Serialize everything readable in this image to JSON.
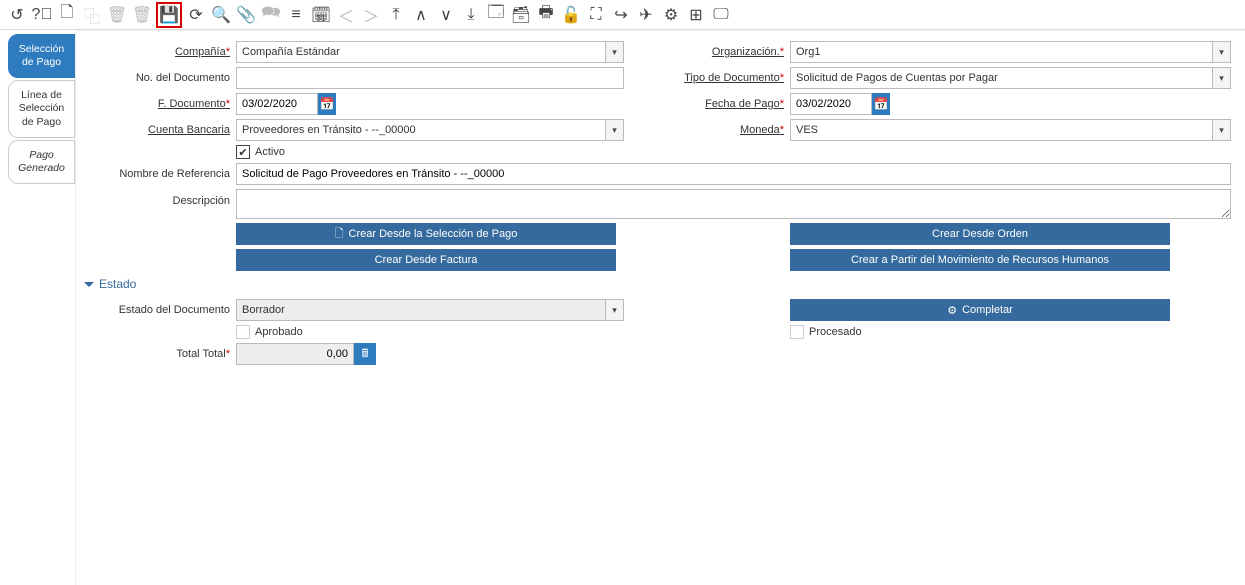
{
  "sidebar": {
    "tabs": [
      {
        "label": "Selección de Pago"
      },
      {
        "label": "Línea de Selección de Pago"
      },
      {
        "label": "Pago Generado"
      }
    ]
  },
  "fields": {
    "compania": {
      "label": "Compañía",
      "value": "Compañía Estándar"
    },
    "organizacion": {
      "label": "Organización.",
      "value": "Org1"
    },
    "no_documento": {
      "label": "No. del Documento",
      "value": ""
    },
    "tipo_documento": {
      "label": "Tipo de Documento",
      "value": "Solicitud de Pagos de Cuentas por Pagar"
    },
    "f_documento": {
      "label": "F. Documento",
      "value": "03/02/2020"
    },
    "fecha_pago": {
      "label": "Fecha de Pago",
      "value": "03/02/2020"
    },
    "cuenta_bancaria": {
      "label": "Cuenta Bancaria",
      "value": "Proveedores en Tránsito - --_00000"
    },
    "moneda": {
      "label": "Moneda",
      "value": "VES"
    },
    "activo": {
      "label": "Activo",
      "checked": true
    },
    "nombre_referencia": {
      "label": "Nombre de Referencia",
      "value": "Solicitud de Pago Proveedores en Tránsito - --_00000"
    },
    "descripcion": {
      "label": "Descripción",
      "value": ""
    },
    "estado_documento": {
      "label": "Estado del Documento",
      "value": "Borrador"
    },
    "aprobado": {
      "label": "Aprobado",
      "checked": false
    },
    "procesado": {
      "label": "Procesado",
      "checked": false
    },
    "total": {
      "label": "Total Total",
      "value": "0,00"
    }
  },
  "buttons": {
    "crear_seleccion": "Crear Desde la Selección de Pago",
    "crear_orden": "Crear Desde Orden",
    "crear_factura": "Crear Desde Factura",
    "crear_rrhh": "Crear a Partir del Movimiento de Recursos Humanos",
    "completar": "Completar"
  },
  "sections": {
    "estado": "Estado"
  }
}
